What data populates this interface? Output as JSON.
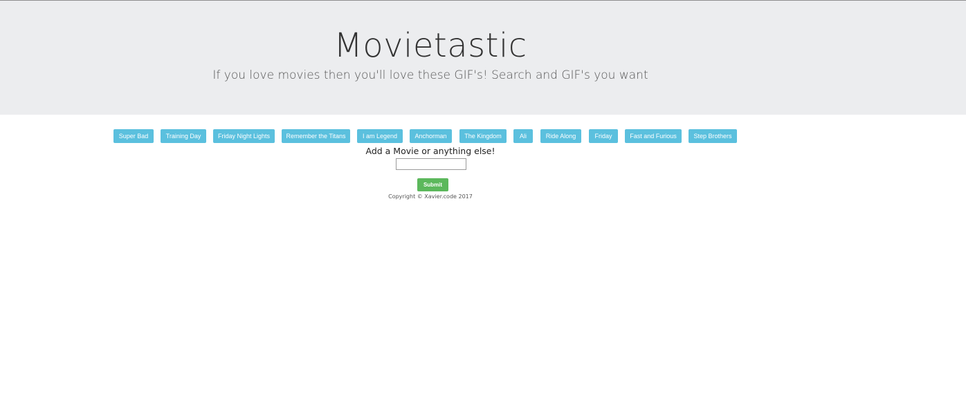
{
  "header": {
    "title": "Movietastic",
    "subtitle": "If you love movies then you'll love these GIF's! Search and GIF's you want"
  },
  "movie_buttons": [
    {
      "label": "Super Bad"
    },
    {
      "label": "Training Day"
    },
    {
      "label": "Friday Night Lights"
    },
    {
      "label": "Remember the Titans"
    },
    {
      "label": "I am Legend"
    },
    {
      "label": "Anchorman"
    },
    {
      "label": "The Kingdom"
    },
    {
      "label": "Ali"
    },
    {
      "label": "Ride Along"
    },
    {
      "label": "Friday"
    },
    {
      "label": "Fast and Furious"
    },
    {
      "label": "Step Brothers"
    }
  ],
  "form": {
    "label": "Add a Movie or anything else!",
    "input_value": "",
    "submit_label": "Submit"
  },
  "footer": {
    "copyright": "Copyright © Xavier.code 2017"
  },
  "colors": {
    "header_bg": "#ecedef",
    "movie_button": "#5bc0de",
    "submit_button": "#5cb85c"
  }
}
